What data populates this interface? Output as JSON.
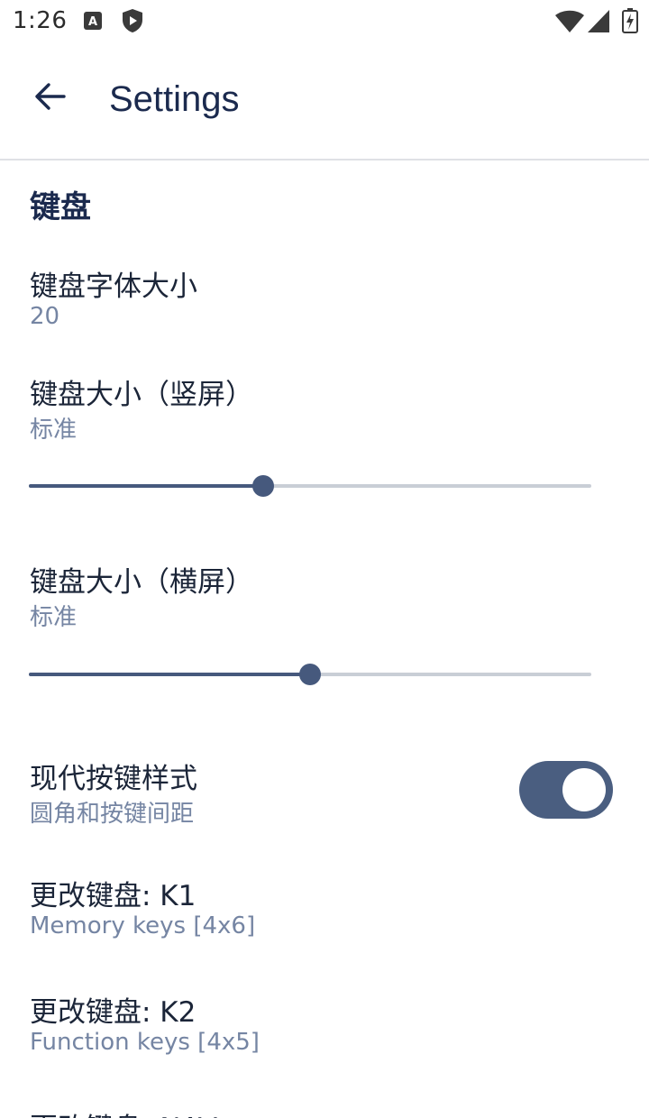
{
  "status_bar": {
    "time": "1:26",
    "icons": [
      "notification-a-icon",
      "shield-play-icon",
      "wifi-icon",
      "cell-signal-icon",
      "battery-charging-icon"
    ]
  },
  "app_bar": {
    "title": "Settings",
    "back_icon": "arrow-left-icon"
  },
  "section": {
    "title": "键盘"
  },
  "prefs": {
    "font_size": {
      "title": "键盘字体大小",
      "summary": "20"
    },
    "size_portrait": {
      "title": "键盘大小（竖屏）",
      "summary": "标准",
      "value_fraction": 0.417
    },
    "size_landscape": {
      "title": "键盘大小（横屏）",
      "summary": "标准",
      "value_fraction": 0.5
    },
    "modern_style": {
      "title": "现代按键样式",
      "summary": "圆角和按键间距",
      "enabled": true
    },
    "k1": {
      "title": "更改键盘: K1",
      "summary": "Memory keys [4x6]"
    },
    "k2": {
      "title": "更改键盘: K2",
      "summary": "Function keys [4x5]"
    },
    "nav": {
      "title": "更改键盘: NAV"
    }
  },
  "colors": {
    "accent": "#46597d",
    "title_text": "#1b2a4e",
    "summary_text": "#7585a3",
    "track_inactive": "#c9ced6",
    "divider": "#dfe1e5"
  }
}
